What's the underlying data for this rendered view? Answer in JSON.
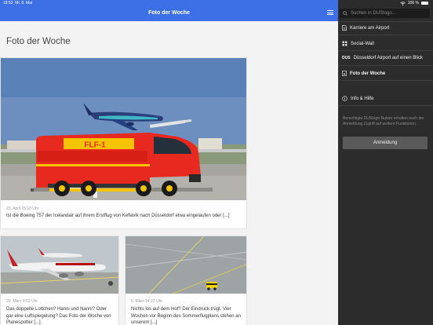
{
  "status": {
    "time": "18:53",
    "date": "Mi. 8. Mai",
    "battery": "100 %"
  },
  "header": {
    "title": "Foto der Woche"
  },
  "page": {
    "title": "Foto der Woche"
  },
  "cards": [
    {
      "date": "23. April 15:18 Uhr",
      "text": "Ist die Boeing 757 der Icelandair auf ihrem Erstflug von Keflavik nach Düsseldorf etwa eingelaufen oder [...]",
      "truck_label": "FLF-1"
    },
    {
      "date": "20. März 9:53 Uhr",
      "text": "Das doppelte Lottchen? Hanni und Nanni? Oder gar eine Luftspiegelung? Das Foto der Woche von Planespotter [...]"
    },
    {
      "date": "5. März 14:22 Uhr",
      "text": "Nichts los auf dem Hof? Der Eindruck trügt. Vier Wochen vor Beginn des Sommerflugplans stehen an unserem [...]"
    }
  ],
  "sidebar": {
    "search_placeholder": "Suchen in DUStogo...",
    "items": [
      {
        "label": "Karriere am Airport",
        "icon": "document-icon"
      },
      {
        "label": "Social-Wall",
        "icon": "grid-icon"
      },
      {
        "label": "Düsseldorf Airport auf einen Blick",
        "icon": "dus-logo-icon",
        "badge": "DUS"
      },
      {
        "label": "Foto der Woche",
        "icon": "photo-icon"
      },
      {
        "label": "Info & Hilfe",
        "icon": "info-icon"
      }
    ],
    "info_text": "Berechtigte DUStogo-Nutzer erhalten nach der Anmeldung Zugriff auf weitere Funktionen.",
    "login_label": "Anmeldung"
  },
  "colors": {
    "accent": "#3d6fe6",
    "sidebar_bg": "#2c2c2c",
    "truck": "#e8291f",
    "stripe": "#f5c400"
  }
}
